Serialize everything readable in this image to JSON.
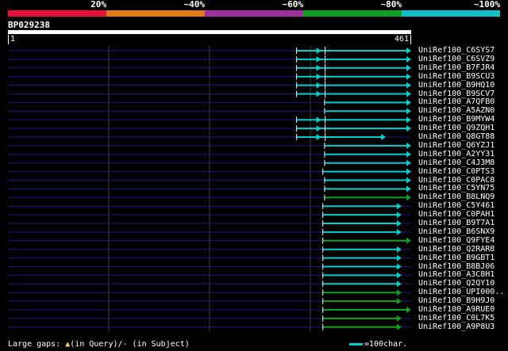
{
  "legend": {
    "labels": [
      "20%",
      "~40%",
      "~60%",
      "~80%",
      "~100%"
    ],
    "colors": [
      "#e6103a",
      "#e07a18",
      "#a030a0",
      "#10a020",
      "#10c0c8"
    ]
  },
  "query": {
    "name": "BP029238",
    "start": "1",
    "end": "461",
    "length": 461
  },
  "hits": [
    {
      "label": "UniRef100_C6SYS7",
      "start": 330,
      "end": 461,
      "color": "#00d0d0",
      "gap": true
    },
    {
      "label": "UniRef100_C6SVZ9",
      "start": 330,
      "end": 461,
      "color": "#00d0d0",
      "gap": true
    },
    {
      "label": "UniRef100_B7FJR4",
      "start": 330,
      "end": 461,
      "color": "#00d0d0",
      "gap": true
    },
    {
      "label": "UniRef100_B9SCU3",
      "start": 330,
      "end": 461,
      "color": "#00d0d0",
      "gap": true
    },
    {
      "label": "UniRef100_B9HQ10",
      "start": 330,
      "end": 461,
      "color": "#00d0d0",
      "gap": true
    },
    {
      "label": "UniRef100_B9SCV7",
      "start": 330,
      "end": 461,
      "color": "#00d0d0",
      "gap": true
    },
    {
      "label": "UniRef100_A7QFB0",
      "start": 362,
      "end": 461,
      "color": "#00d0d0",
      "gap": false
    },
    {
      "label": "UniRef100_A5AZN0",
      "start": 362,
      "end": 461,
      "color": "#00d0d0",
      "gap": false
    },
    {
      "label": "UniRef100_B9MYW4",
      "start": 330,
      "end": 461,
      "color": "#00d0d0",
      "gap": true
    },
    {
      "label": "UniRef100_Q9ZQH1",
      "start": 330,
      "end": 461,
      "color": "#00d0d0",
      "gap": true
    },
    {
      "label": "UniRef100_Q8GT88",
      "start": 330,
      "end": 432,
      "color": "#00d0d0",
      "gap": true
    },
    {
      "label": "UniRef100_Q6YZJ1",
      "start": 362,
      "end": 461,
      "color": "#00d0d0",
      "gap": false
    },
    {
      "label": "UniRef100_A2YY31",
      "start": 362,
      "end": 461,
      "color": "#00d0d0",
      "gap": false
    },
    {
      "label": "UniRef100_C4J3M8",
      "start": 362,
      "end": 461,
      "color": "#00d0d0",
      "gap": false
    },
    {
      "label": "UniRef100_C0PTS3",
      "start": 360,
      "end": 461,
      "color": "#00d0d0",
      "gap": false
    },
    {
      "label": "UniRef100_C0PAC8",
      "start": 362,
      "end": 461,
      "color": "#00d0d0",
      "gap": false
    },
    {
      "label": "UniRef100_C5YN75",
      "start": 362,
      "end": 461,
      "color": "#00d0d0",
      "gap": false
    },
    {
      "label": "UniRef100_B8LNQ9",
      "start": 362,
      "end": 461,
      "color": "#10a020",
      "gap": false
    },
    {
      "label": "UniRef100_C5Y461",
      "start": 360,
      "end": 450,
      "color": "#00d0d0",
      "gap": false
    },
    {
      "label": "UniRef100_C0PAH1",
      "start": 360,
      "end": 450,
      "color": "#00d0d0",
      "gap": false
    },
    {
      "label": "UniRef100_B9T7A1",
      "start": 360,
      "end": 450,
      "color": "#00d0d0",
      "gap": false
    },
    {
      "label": "UniRef100_B6SNX9",
      "start": 360,
      "end": 450,
      "color": "#00d0d0",
      "gap": false
    },
    {
      "label": "UniRef100_Q9FYE4",
      "start": 360,
      "end": 461,
      "color": "#10a020",
      "gap": false
    },
    {
      "label": "UniRef100_Q2RAR8",
      "start": 360,
      "end": 450,
      "color": "#00d0d0",
      "gap": false
    },
    {
      "label": "UniRef100_B9GBT1",
      "start": 360,
      "end": 450,
      "color": "#00d0d0",
      "gap": false
    },
    {
      "label": "UniRef100_B8BJ06",
      "start": 360,
      "end": 450,
      "color": "#00d0d0",
      "gap": false
    },
    {
      "label": "UniRef100_A3C8H1",
      "start": 360,
      "end": 450,
      "color": "#00d0d0",
      "gap": false
    },
    {
      "label": "UniRef100_Q2QY10",
      "start": 360,
      "end": 450,
      "color": "#00d0d0",
      "gap": false
    },
    {
      "label": "UniRef100_UPI000..",
      "start": 360,
      "end": 450,
      "color": "#10a020",
      "gap": false
    },
    {
      "label": "UniRef100_B9H9J0",
      "start": 360,
      "end": 450,
      "color": "#10a020",
      "gap": false
    },
    {
      "label": "UniRef100_A9RUE0",
      "start": 360,
      "end": 461,
      "color": "#10a020",
      "gap": false
    },
    {
      "label": "UniRef100_C0L7K5",
      "start": 360,
      "end": 450,
      "color": "#10a020",
      "gap": false
    },
    {
      "label": "UniRef100_A9P8U3",
      "start": 360,
      "end": 450,
      "color": "#10a020",
      "gap": false
    }
  ],
  "footer": {
    "gaps_prefix": "Large gaps: ",
    "gaps_query_glyph": "▲",
    "gaps_text": "(in Query)/- (in Subject)",
    "key_text": "=100char."
  },
  "colors": {
    "track": "#1a1a80",
    "gridline": "#404040"
  }
}
